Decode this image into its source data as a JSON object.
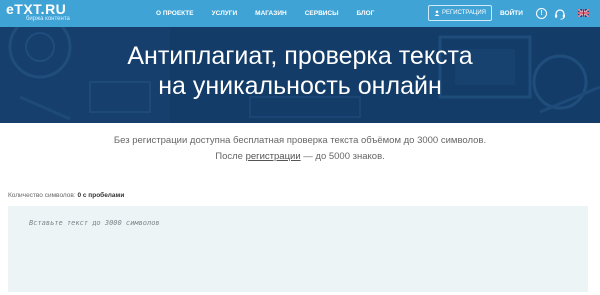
{
  "logo": {
    "main": "TXT.RU",
    "e": "e",
    "sub": "биржа контента"
  },
  "nav": {
    "items": [
      {
        "label": "О ПРОЕКТЕ"
      },
      {
        "label": "УСЛУГИ"
      },
      {
        "label": "МАГАЗИН"
      },
      {
        "label": "СЕРВИСЫ"
      },
      {
        "label": "БЛОГ"
      }
    ],
    "register_label": "РЕГИСТРАЦИЯ",
    "login_label": "ВОЙТИ",
    "help_label": "!"
  },
  "hero": {
    "line1": "Антиплагиат, проверка текста",
    "line2": "на уникальность онлайн"
  },
  "info": {
    "line1": "Без регистрации доступна бесплатная проверка текста объёмом до 3000 символов.",
    "line2_before": "После ",
    "line2_link": "регистрации",
    "line2_after": " — до 5000 знаков."
  },
  "counter": {
    "label": "Количество символов:",
    "value": "0 с пробелами"
  },
  "editor": {
    "placeholder": "Вставьте текст до 3000 символов"
  },
  "colors": {
    "nav_bg": "#3fa3d6",
    "hero_bg": "#123a66",
    "editor_bg": "#edf4f5"
  },
  "icons": {
    "help": "exclamation-circle-icon",
    "support": "headset-icon",
    "language": "uk-flag-icon",
    "register": "user-icon"
  }
}
